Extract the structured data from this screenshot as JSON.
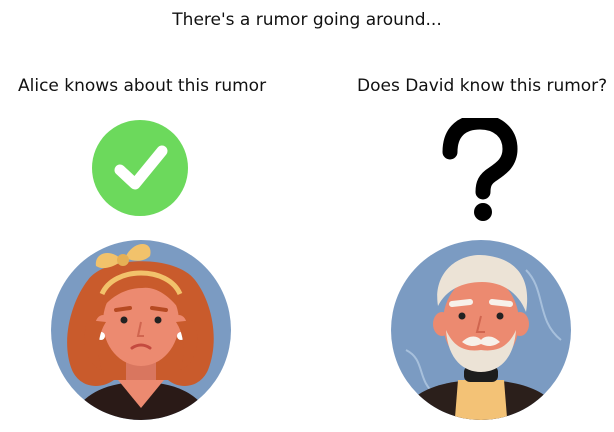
{
  "title": "There's a rumor going around...",
  "left_panel": {
    "label": "Alice knows about this rumor",
    "status_icon": "check-circle-icon",
    "avatar": "woman-avatar-icon"
  },
  "right_panel": {
    "label": "Does David know this rumor?",
    "status_icon": "question-mark-icon",
    "avatar": "old-man-avatar-icon"
  },
  "colors": {
    "check_green": "#6cd95c",
    "avatar_bg": "#7b9bc2",
    "skin": "#ec8a70",
    "alice_hair": "#c95b2c",
    "david_hair": "#ece3d6"
  }
}
